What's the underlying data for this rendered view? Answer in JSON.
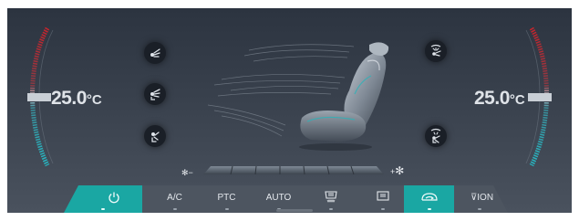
{
  "left_zone": {
    "temp_value": "25.0",
    "temp_unit": "°C"
  },
  "right_zone": {
    "temp_value": "25.0",
    "temp_unit": "°C"
  },
  "fan": {
    "decrease_symbol": "−",
    "increase_symbol": "+",
    "level": 0
  },
  "buttons": {
    "power": {
      "icon": "power-icon",
      "active": true
    },
    "ac": {
      "label": "A/C",
      "active": false
    },
    "ptc": {
      "label": "PTC",
      "active": false
    },
    "auto": {
      "label": "AUTO",
      "active": false
    },
    "rear_defrost": {
      "icon": "rear-defrost-icon",
      "active": false
    },
    "front_defrost": {
      "icon": "front-defrost-icon",
      "active": false
    },
    "recirculation": {
      "icon": "recirculation-icon",
      "active": true
    },
    "ion": {
      "label": "ION",
      "icon": "ion-icon",
      "active": false
    }
  },
  "colors": {
    "accent": "#1aa7a3",
    "cool_gauge": "#26b9c4",
    "warm_gauge": "#c8242c",
    "panel_bg": "#333b47"
  }
}
